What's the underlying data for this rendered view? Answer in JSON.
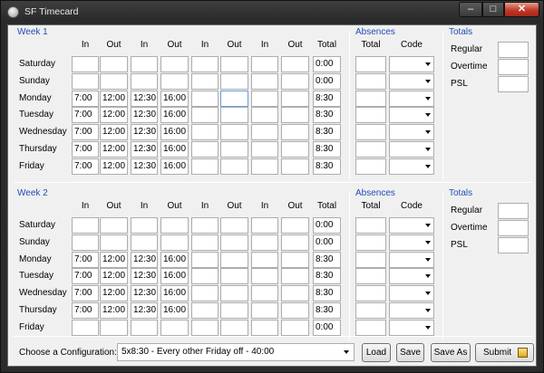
{
  "window": {
    "title": "SF Timecard"
  },
  "controls": {
    "minimize": "–",
    "maximize": "□",
    "close": "✕"
  },
  "column_headers": [
    "In",
    "Out",
    "In",
    "Out",
    "In",
    "Out",
    "In",
    "Out",
    "Total"
  ],
  "absences": {
    "title": "Absences",
    "headers": [
      "Total",
      "Code"
    ]
  },
  "totals": {
    "title": "Totals",
    "labels": [
      "Regular",
      "Overtime",
      "PSL"
    ]
  },
  "weeks": [
    {
      "title": "Week 1",
      "rows": [
        {
          "day": "Saturday",
          "times": [
            "",
            "",
            "",
            "",
            "",
            "",
            "",
            ""
          ],
          "total": "0:00"
        },
        {
          "day": "Sunday",
          "times": [
            "",
            "",
            "",
            "",
            "",
            "",
            "",
            ""
          ],
          "total": "0:00"
        },
        {
          "day": "Monday",
          "times": [
            "7:00",
            "12:00",
            "12:30",
            "16:00",
            "",
            "",
            "",
            ""
          ],
          "total": "8:30"
        },
        {
          "day": "Tuesday",
          "times": [
            "7:00",
            "12:00",
            "12:30",
            "16:00",
            "",
            "",
            "",
            ""
          ],
          "total": "8:30"
        },
        {
          "day": "Wednesday",
          "times": [
            "7:00",
            "12:00",
            "12:30",
            "16:00",
            "",
            "",
            "",
            ""
          ],
          "total": "8:30"
        },
        {
          "day": "Thursday",
          "times": [
            "7:00",
            "12:00",
            "12:30",
            "16:00",
            "",
            "",
            "",
            ""
          ],
          "total": "8:30"
        },
        {
          "day": "Friday",
          "times": [
            "7:00",
            "12:00",
            "12:30",
            "16:00",
            "",
            "",
            "",
            ""
          ],
          "total": "8:30"
        }
      ]
    },
    {
      "title": "Week 2",
      "rows": [
        {
          "day": "Saturday",
          "times": [
            "",
            "",
            "",
            "",
            "",
            "",
            "",
            ""
          ],
          "total": "0:00"
        },
        {
          "day": "Sunday",
          "times": [
            "",
            "",
            "",
            "",
            "",
            "",
            "",
            ""
          ],
          "total": "0:00"
        },
        {
          "day": "Monday",
          "times": [
            "7:00",
            "12:00",
            "12:30",
            "16:00",
            "",
            "",
            "",
            ""
          ],
          "total": "8:30"
        },
        {
          "day": "Tuesday",
          "times": [
            "7:00",
            "12:00",
            "12:30",
            "16:00",
            "",
            "",
            "",
            ""
          ],
          "total": "8:30"
        },
        {
          "day": "Wednesday",
          "times": [
            "7:00",
            "12:00",
            "12:30",
            "16:00",
            "",
            "",
            "",
            ""
          ],
          "total": "8:30"
        },
        {
          "day": "Thursday",
          "times": [
            "7:00",
            "12:00",
            "12:30",
            "16:00",
            "",
            "",
            "",
            ""
          ],
          "total": "8:30"
        },
        {
          "day": "Friday",
          "times": [
            "",
            "",
            "",
            "",
            "",
            "",
            "",
            ""
          ],
          "total": "0:00"
        }
      ]
    }
  ],
  "footer": {
    "config_label": "Choose a Configuration:",
    "config_value": "5x8:30 - Every other Friday off - 40:00",
    "load": "Load",
    "save": "Save",
    "save_as": "Save As",
    "submit": "Submit"
  }
}
